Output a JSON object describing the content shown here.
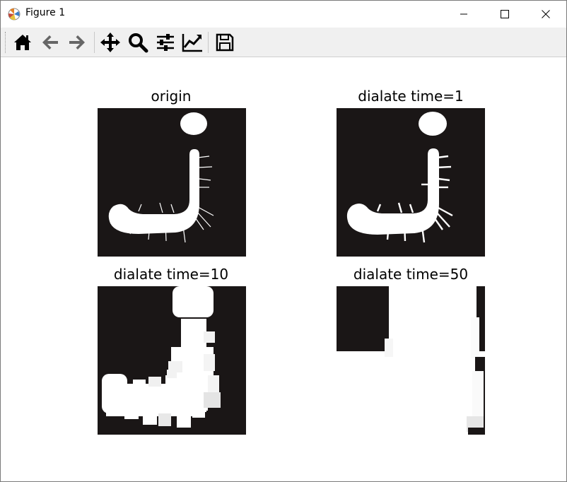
{
  "window": {
    "title": "Figure 1",
    "controls": {
      "minimize": "minimize",
      "maximize": "maximize",
      "close": "close"
    }
  },
  "toolbar": {
    "buttons": [
      "home-icon",
      "back-icon",
      "forward-icon",
      "pan-icon",
      "zoom-icon",
      "configure-subplots-icon",
      "edit-axis-icon",
      "save-icon"
    ]
  },
  "figure": {
    "subplots": [
      {
        "title": "origin"
      },
      {
        "title": "dialate time=1"
      },
      {
        "title": "dialate time=10"
      },
      {
        "title": "dialate time=50"
      }
    ],
    "colors": {
      "background": "#1a1616",
      "foreground": "#ffffff"
    }
  }
}
